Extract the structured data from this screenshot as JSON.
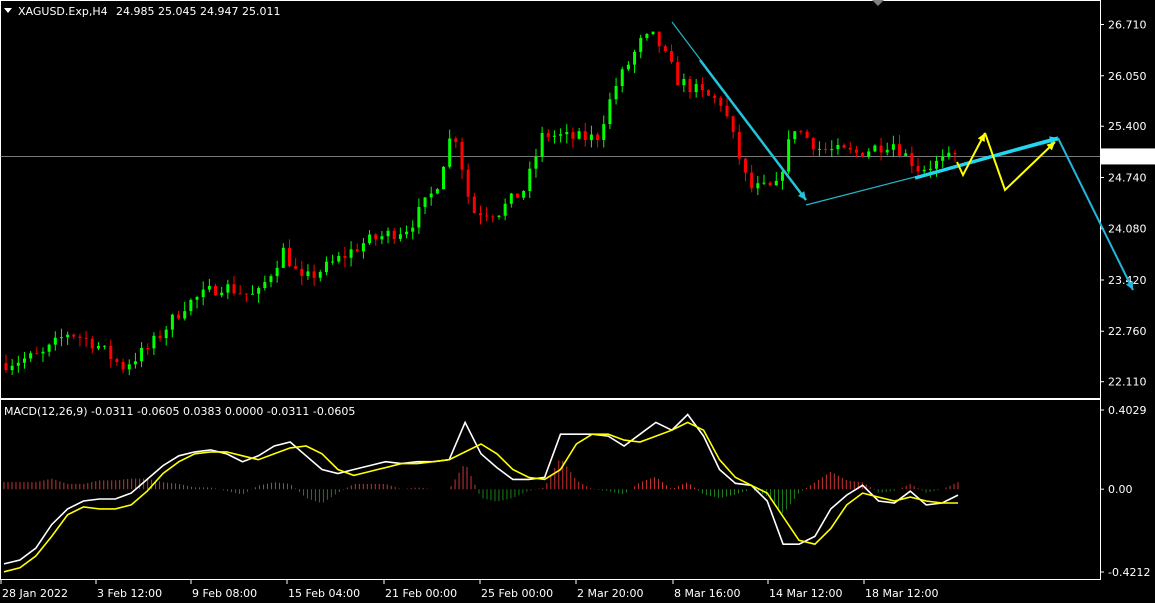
{
  "chart_data": [
    {
      "type": "candlestick",
      "symbol_header": "XAGUSD.Exp,H4",
      "ohlc_header": "24.985 25.045 24.947 25.011",
      "current_price_label": "25.011",
      "current_price": 25.011,
      "ylim": [
        21.9,
        27.0
      ],
      "y_ticks": [
        "26.710",
        "26.050",
        "25.400",
        "24.740",
        "24.080",
        "23.420",
        "22.760",
        "22.110"
      ],
      "x_ticks": [
        "28 Jan 2022",
        "3 Feb 12:00",
        "9 Feb 08:00",
        "15 Feb 04:00",
        "21 Feb 00:00",
        "25 Feb 00:00",
        "2 Mar 20:00",
        "8 Mar 16:00",
        "14 Mar 12:00",
        "18 Mar 12:00"
      ],
      "bar_count": 155,
      "price_path": [
        [
          0,
          22.35
        ],
        [
          8,
          22.45
        ],
        [
          14,
          22.75
        ],
        [
          20,
          22.6
        ],
        [
          26,
          22.3
        ],
        [
          32,
          22.55
        ],
        [
          40,
          23.1
        ],
        [
          48,
          23.35
        ],
        [
          56,
          23.2
        ],
        [
          62,
          23.8
        ],
        [
          66,
          23.4
        ],
        [
          72,
          23.6
        ],
        [
          80,
          23.9
        ],
        [
          90,
          24.1
        ],
        [
          96,
          24.6
        ],
        [
          100,
          25.4
        ],
        [
          104,
          24.3
        ],
        [
          110,
          24.3
        ],
        [
          116,
          24.6
        ],
        [
          120,
          25.3
        ],
        [
          126,
          25.25
        ],
        [
          132,
          25.25
        ],
        [
          136,
          25.9
        ],
        [
          142,
          26.5
        ],
        [
          145,
          26.55
        ],
        [
          150,
          26.0
        ],
        [
          156,
          25.8
        ],
        [
          160,
          25.7
        ],
        [
          166,
          24.6
        ],
        [
          172,
          24.6
        ],
        [
          176,
          25.4
        ],
        [
          182,
          25.1
        ],
        [
          190,
          25.05
        ],
        [
          198,
          25.2
        ],
        [
          204,
          24.85
        ],
        [
          212,
          25.0
        ]
      ],
      "colors": {
        "up": "#00ff00",
        "down": "#ff0000",
        "grid_line": "#c0c0c0",
        "axis": "#ffffff"
      }
    },
    {
      "type": "line",
      "indicator_label": "MACD(12,26,9) -0.0311 -0.0605 0.0383 0.0000 -0.0311 -0.0605",
      "ylim": [
        -0.4212,
        0.4029
      ],
      "y_ticks": [
        "0.4029",
        "0.00",
        "-0.4212"
      ],
      "series": [
        {
          "color": "#ffffff",
          "values": [
            -0.38,
            -0.36,
            -0.3,
            -0.18,
            -0.1,
            -0.06,
            -0.05,
            -0.05,
            -0.02,
            0.05,
            0.12,
            0.17,
            0.19,
            0.2,
            0.18,
            0.14,
            0.17,
            0.22,
            0.24,
            0.17,
            0.1,
            0.08,
            0.1,
            0.12,
            0.14,
            0.13,
            0.14,
            0.14,
            0.15,
            0.34,
            0.18,
            0.11,
            0.05,
            0.05,
            0.06,
            0.28,
            0.28,
            0.28,
            0.27,
            0.22,
            0.28,
            0.34,
            0.3,
            0.38,
            0.27,
            0.1,
            0.03,
            0.02,
            -0.06,
            -0.28,
            -0.28,
            -0.24,
            -0.1,
            -0.03,
            0.02,
            -0.06,
            -0.07,
            -0.01,
            -0.08,
            -0.07,
            -0.03
          ]
        },
        {
          "color": "#ffff00",
          "values": [
            -0.42,
            -0.4,
            -0.34,
            -0.24,
            -0.13,
            -0.09,
            -0.1,
            -0.1,
            -0.08,
            -0.01,
            0.08,
            0.14,
            0.18,
            0.19,
            0.19,
            0.17,
            0.15,
            0.18,
            0.21,
            0.22,
            0.18,
            0.1,
            0.07,
            0.09,
            0.11,
            0.13,
            0.13,
            0.14,
            0.15,
            0.19,
            0.23,
            0.18,
            0.1,
            0.06,
            0.05,
            0.1,
            0.23,
            0.28,
            0.28,
            0.25,
            0.24,
            0.27,
            0.3,
            0.34,
            0.3,
            0.15,
            0.06,
            0.02,
            -0.02,
            -0.14,
            -0.26,
            -0.28,
            -0.2,
            -0.08,
            -0.02,
            -0.04,
            -0.06,
            -0.04,
            -0.06,
            -0.07,
            -0.07
          ]
        }
      ]
    }
  ]
}
